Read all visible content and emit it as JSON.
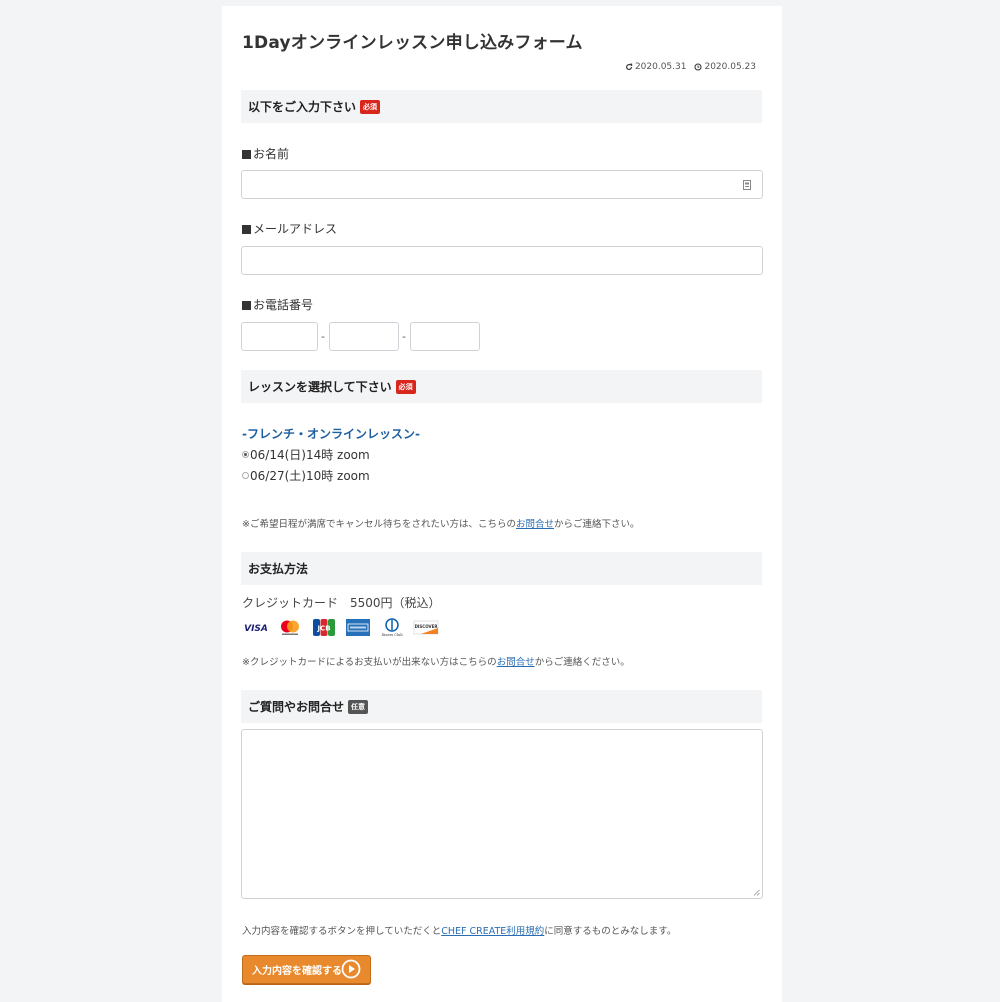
{
  "page": {
    "title": "1Dayオンラインレッスン申し込みフォーム",
    "updated_date": "2020.05.31",
    "published_date": "2020.05.23"
  },
  "section_required": {
    "title": "以下をご入力下さい",
    "badge": "必須"
  },
  "fields": {
    "name_label": "お名前",
    "email_label": "メールアドレス",
    "phone_label": "お電話番号",
    "phone_separator": "-"
  },
  "section_lesson": {
    "title": "レッスンを選択して下さい",
    "badge": "必須",
    "lesson_title": "-フレンチ・オンラインレッスン-",
    "options": [
      {
        "label": "06/14(日)14時 zoom",
        "checked": true
      },
      {
        "label": "06/27(土)10時 zoom",
        "checked": false
      }
    ],
    "note_prefix": "※ご希望日程が満席でキャンセル待ちをされたい方は、こちらの",
    "note_link": "お問合せ",
    "note_suffix": "からご連絡下さい。"
  },
  "section_payment": {
    "title": "お支払方法",
    "price_text": "クレジットカード　5500円（税込）",
    "card_icons": [
      "visa-icon",
      "mastercard-icon",
      "jcb-icon",
      "amex-icon",
      "diners-club-icon",
      "discover-icon"
    ],
    "card_visa_text": "VISA",
    "card_jcb_text": "JCB",
    "card_diners_text": "Diners Club",
    "card_discover_text": "DISCOVER",
    "note_prefix": "※クレジットカードによるお支払いが出来ない方はこちらの",
    "note_link": "お問合せ",
    "note_suffix": "からご連絡ください。"
  },
  "section_question": {
    "title": "ご質問やお問合せ",
    "badge": "任意"
  },
  "consent": {
    "prefix": "入力内容を確認するボタンを押していただくと",
    "link": "CHEF CREATE利用規約",
    "suffix": "に同意するものとみなします。"
  },
  "submit": {
    "label": "入力内容を確認する"
  },
  "colors": {
    "background": "#f3f4f6",
    "required_badge": "#d9261c",
    "optional_badge": "#555555",
    "lesson_title": "#1f5fa0",
    "link": "#2a6db3",
    "submit_button": "#e8892d"
  }
}
